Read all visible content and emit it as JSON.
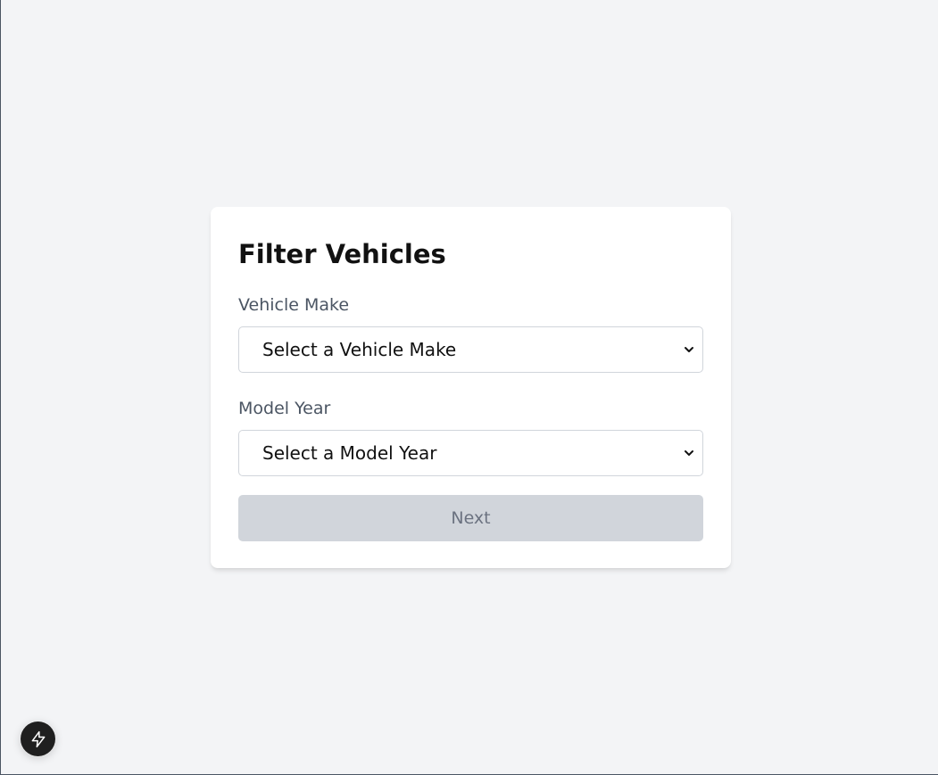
{
  "form": {
    "title": "Filter Vehicles",
    "make": {
      "label": "Vehicle Make",
      "selected": "Select a Vehicle Make"
    },
    "year": {
      "label": "Model Year",
      "selected": "Select a Model Year"
    },
    "next_label": "Next",
    "next_disabled": true
  },
  "dev_badge": {
    "icon": "lightning-bolt-icon"
  },
  "colors": {
    "page_background": "#f3f4f6",
    "card_background": "#ffffff",
    "label_text": "#4b5563",
    "disabled_button_background": "#d1d5db",
    "disabled_button_text": "#6b7280",
    "badge_background": "#1f1f1f"
  }
}
